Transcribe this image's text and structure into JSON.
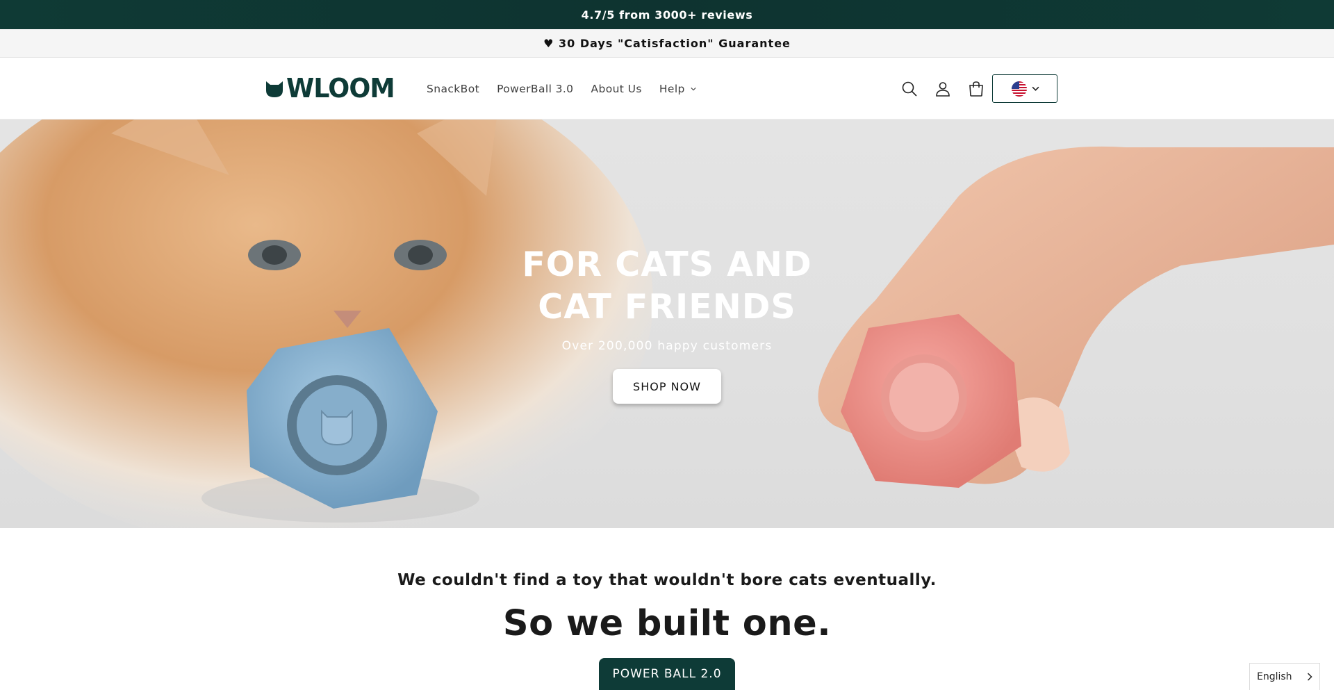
{
  "announcement": {
    "text": "4.7/5 from 3000+ reviews"
  },
  "guarantee": {
    "text": "♥ 30 Days \"Catisfaction\" Guarantee"
  },
  "header": {
    "logo_text": "WLOOM",
    "nav": [
      {
        "label": "SnackBot"
      },
      {
        "label": "PowerBall 3.0"
      },
      {
        "label": "About Us"
      },
      {
        "label": "Help"
      }
    ],
    "icons": [
      "search-icon",
      "account-icon",
      "cart-icon"
    ],
    "locale_flag": "us-flag-icon"
  },
  "hero": {
    "title": "FOR CATS AND CAT FRIENDS",
    "subtitle": "Over 200,000 happy customers",
    "button": "SHOP NOW"
  },
  "intro": {
    "tagline": "We couldn't find a toy that wouldn't bore cats eventually.",
    "headline": "So we built one.",
    "button": "POWER BALL 2.0"
  },
  "language_widget": {
    "label": "English"
  },
  "colors": {
    "brand": "#0e3b37",
    "topbar": "#0f3a35",
    "hero_bg": "#e0e0e0"
  }
}
